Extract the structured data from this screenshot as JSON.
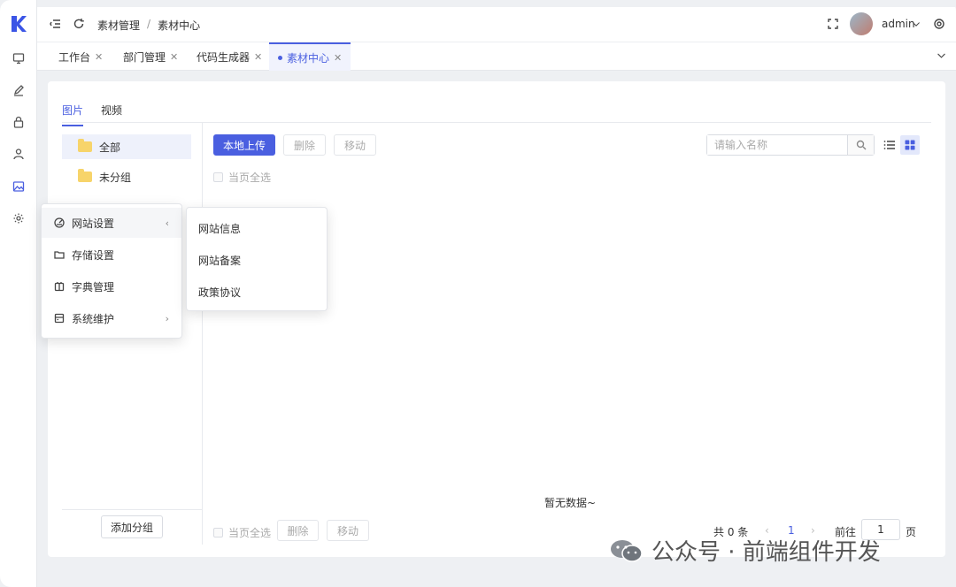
{
  "header": {
    "breadcrumb": [
      "素材管理",
      "素材中心"
    ],
    "breadcrumb_sep": "/",
    "username": "admin"
  },
  "tabs": [
    {
      "label": "工作台"
    },
    {
      "label": "部门管理"
    },
    {
      "label": "代码生成器"
    },
    {
      "label": "素材中心",
      "active": true
    }
  ],
  "media_tabs": [
    "图片",
    "视频"
  ],
  "groups": [
    {
      "label": "全部",
      "selected": true
    },
    {
      "label": "未分组"
    }
  ],
  "group_footer": {
    "add_label": "添加分组"
  },
  "toolbar": {
    "upload": "本地上传",
    "delete": "删除",
    "move": "移动",
    "select_page": "当页全选"
  },
  "search": {
    "placeholder": "请输入名称"
  },
  "empty_text": "暂无数据~",
  "footer": {
    "select_page": "当页全选",
    "delete": "删除",
    "move": "移动",
    "total": "共 0 条",
    "current_page": "1",
    "goto_label": "前往",
    "goto_value": "1",
    "page_unit": "页"
  },
  "context_menu": [
    {
      "label": "网站设置",
      "icon": "dashboard-icon",
      "has_sub": true,
      "arrow": "‹"
    },
    {
      "label": "存储设置",
      "icon": "folder-icon"
    },
    {
      "label": "字典管理",
      "icon": "book-icon"
    },
    {
      "label": "系统维护",
      "icon": "server-icon",
      "has_sub": true,
      "arrow": "›"
    }
  ],
  "submenu": [
    "网站信息",
    "网站备案",
    "政策协议"
  ],
  "watermark": "公众号 · 前端组件开发",
  "colors": {
    "accent": "#4a5fe0",
    "folder": "#f7d46a"
  }
}
